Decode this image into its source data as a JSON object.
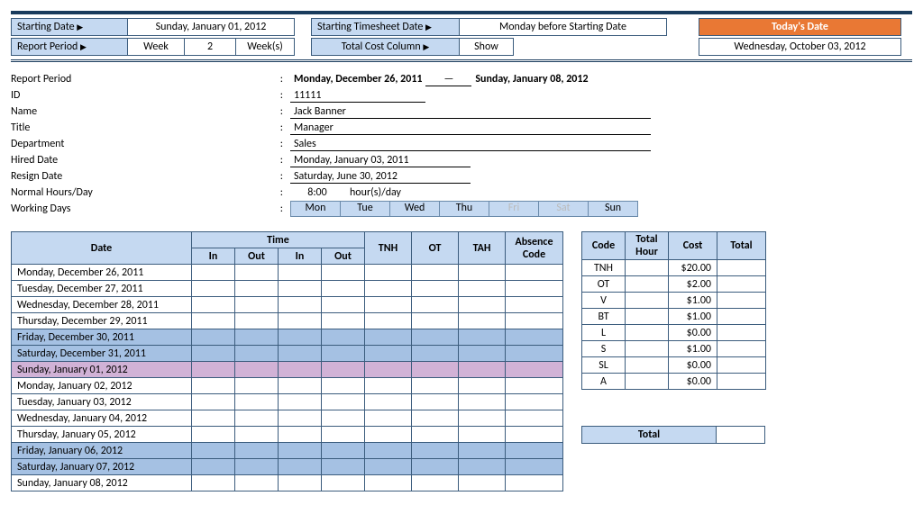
{
  "header": {
    "starting_date_label": "Starting Date",
    "starting_date": "Sunday, January 01, 2012",
    "starting_ts_label": "Starting Timesheet Date",
    "starting_ts_value": "Monday before Starting Date",
    "todays_date_label": "Today's Date",
    "todays_date": "Wednesday, October 03, 2012",
    "report_period_label": "Report Period",
    "week_label": "Week",
    "week_num": "2",
    "week_unit": "Week(s)",
    "total_cost_label": "Total Cost Column",
    "total_cost_value": "Show"
  },
  "info": {
    "report_period_label": "Report Period",
    "report_start": "Monday, December 26, 2011",
    "report_end": "Sunday, January 08, 2012",
    "id_label": "ID",
    "id": "11111",
    "name_label": "Name",
    "name": "Jack Banner",
    "title_label": "Title",
    "title": "Manager",
    "department_label": "Department",
    "department": "Sales",
    "hired_label": "Hired Date",
    "hired": "Monday, January 03, 2011",
    "resign_label": "Resign Date",
    "resign": "Saturday, June 30, 2012",
    "hours_label": "Normal Hours/Day",
    "hours": "8:00",
    "hours_unit": "hour(s)/day",
    "days_label": "Working Days",
    "days": [
      "Mon",
      "Tue",
      "Wed",
      "Thu",
      "Fri",
      "Sat",
      "Sun"
    ],
    "days_active": [
      true,
      true,
      true,
      true,
      false,
      false,
      true
    ]
  },
  "timesheet": {
    "headers": {
      "date": "Date",
      "time": "Time",
      "in": "In",
      "out": "Out",
      "tnh": "TNH",
      "ot": "OT",
      "tah": "TAH",
      "abs": "Absence Code"
    },
    "rows": [
      {
        "date": "Monday, December 26, 2011",
        "style": ""
      },
      {
        "date": "Tuesday, December 27, 2011",
        "style": ""
      },
      {
        "date": "Wednesday, December 28, 2011",
        "style": ""
      },
      {
        "date": "Thursday, December 29, 2011",
        "style": ""
      },
      {
        "date": "Friday, December 30, 2011",
        "style": "blue"
      },
      {
        "date": "Saturday, December 31, 2011",
        "style": "blue"
      },
      {
        "date": "Sunday, January 01, 2012",
        "style": "pink"
      },
      {
        "date": "Monday, January 02, 2012",
        "style": ""
      },
      {
        "date": "Tuesday, January 03, 2012",
        "style": ""
      },
      {
        "date": "Wednesday, January 04, 2012",
        "style": ""
      },
      {
        "date": "Thursday, January 05, 2012",
        "style": ""
      },
      {
        "date": "Friday, January 06, 2012",
        "style": "blue"
      },
      {
        "date": "Saturday, January 07, 2012",
        "style": "blue"
      },
      {
        "date": "Sunday, January 08, 2012",
        "style": ""
      }
    ]
  },
  "costs": {
    "headers": {
      "code": "Code",
      "total_hour": "Total Hour",
      "cost": "Cost",
      "total": "Total"
    },
    "rows": [
      {
        "code": "TNH",
        "cost": "$20.00"
      },
      {
        "code": "OT",
        "cost": "$2.00"
      },
      {
        "code": "V",
        "cost": "$1.00"
      },
      {
        "code": "BT",
        "cost": "$1.00"
      },
      {
        "code": "L",
        "cost": "$0.00"
      },
      {
        "code": "S",
        "cost": "$1.00"
      },
      {
        "code": "SL",
        "cost": "$0.00"
      },
      {
        "code": "A",
        "cost": "$0.00"
      }
    ],
    "total_label": "Total"
  },
  "glyph": {
    "arrow": "▶"
  }
}
